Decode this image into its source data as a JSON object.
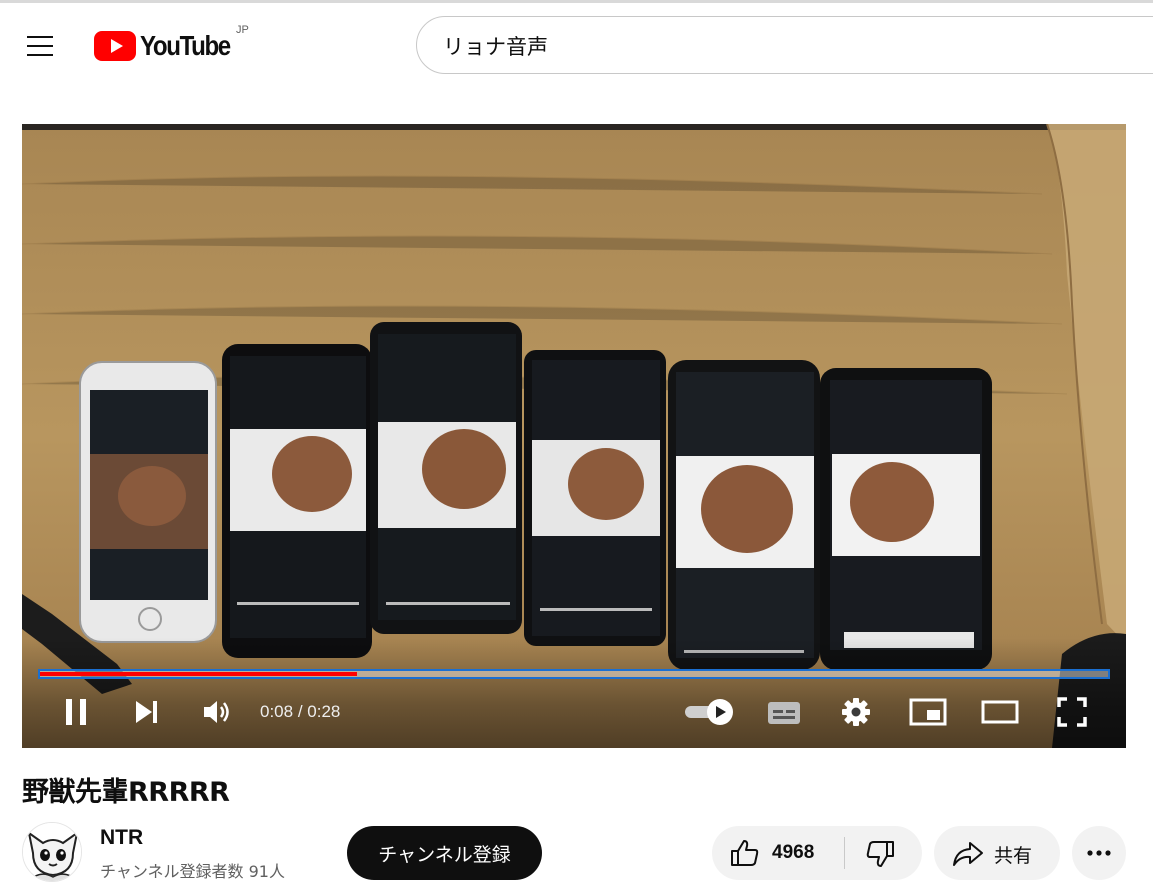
{
  "masthead": {
    "logo_text": "YouTube",
    "country_code": "JP",
    "search_query": "リョナ音声"
  },
  "player": {
    "time_current": "0:08",
    "time_separator": " / ",
    "time_total": "0:28",
    "progress_fraction": 0.297,
    "is_playing": true,
    "autoplay_on": true
  },
  "video": {
    "title": "野獣先輩RRRRR"
  },
  "channel": {
    "name": "NTR",
    "subscribers": "チャンネル登録者数 91人",
    "subscribe_label": "チャンネル登録"
  },
  "actions": {
    "like_count": "4968",
    "share_label": "共有"
  },
  "colors": {
    "brand_red": "#ff0000",
    "progress_outline": "#1a6fd1",
    "button_dark": "#0f0f0f",
    "pill_bg": "#f2f2f2"
  },
  "icons": [
    "menu-icon",
    "youtube-play-icon",
    "pause-icon",
    "next-icon",
    "volume-icon",
    "autoplay-toggle-icon",
    "subtitles-icon",
    "settings-icon",
    "miniplayer-icon",
    "theater-icon",
    "fullscreen-icon",
    "thumbs-up-icon",
    "thumbs-down-icon",
    "share-icon",
    "more-icon"
  ]
}
